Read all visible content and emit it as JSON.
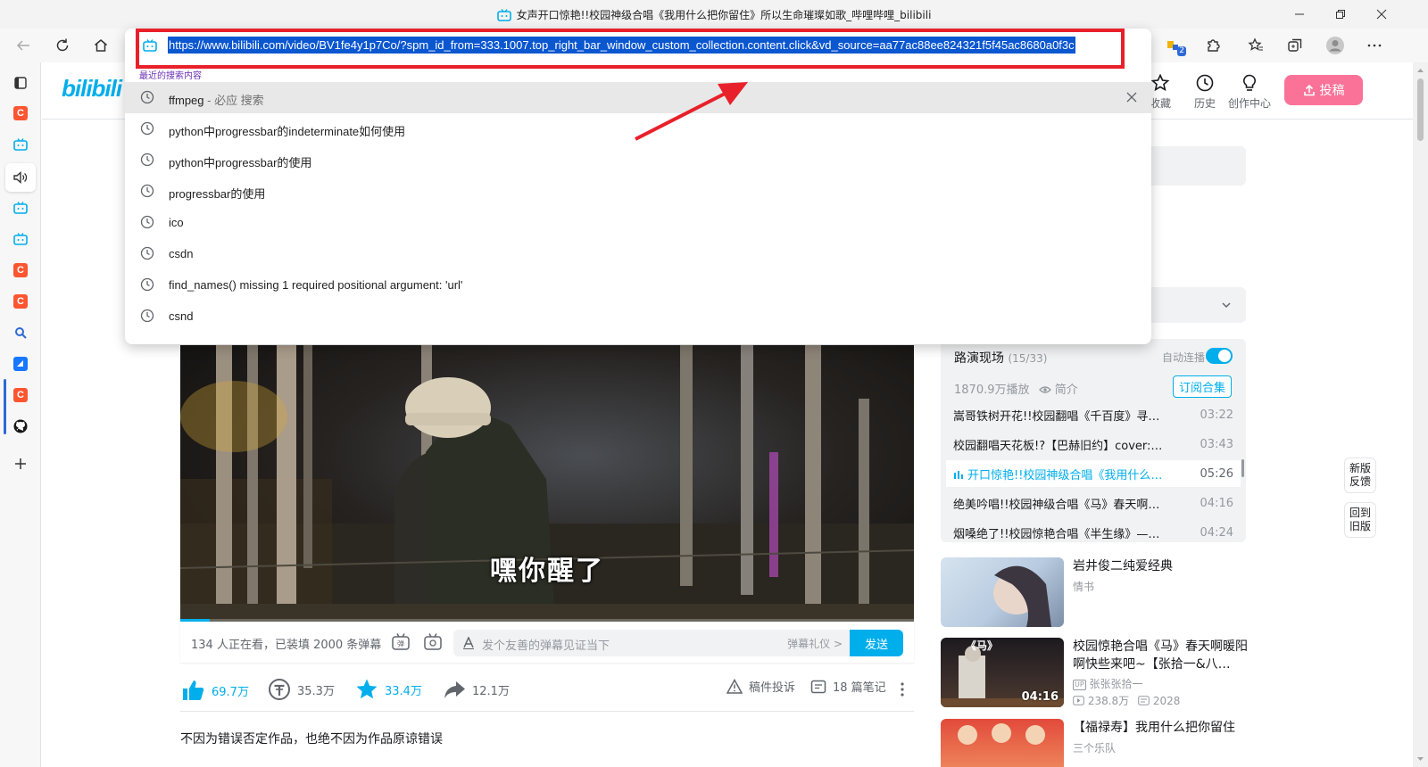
{
  "window": {
    "title": "女声开口惊艳!!校园神级合唱《我用什么把你留住》所以生命璀璨如歌_哔哩哔哩_bilibili"
  },
  "toolbar": {
    "extension_badge": "2"
  },
  "omnibox": {
    "url": "https://www.bilibili.com/video/BV1fe4y1p7Co/?spm_id_from=333.1007.top_right_bar_window_custom_collection.content.click&vd_source=aa77ac88ee824321f5f45ac8680a0f3c",
    "recent_label": "最近的搜索内容",
    "suggestions": [
      {
        "text": "ffmpeg",
        "hint": " - 必应 搜索"
      },
      {
        "text": "python中progressbar的indeterminate如何使用",
        "hint": ""
      },
      {
        "text": "python中progressbar的使用",
        "hint": ""
      },
      {
        "text": "progressbar的使用",
        "hint": ""
      },
      {
        "text": "ico",
        "hint": ""
      },
      {
        "text": "csdn",
        "hint": ""
      },
      {
        "text": "find_names() missing 1 required positional argument: 'url'",
        "hint": ""
      },
      {
        "text": "csnd",
        "hint": ""
      }
    ]
  },
  "site": {
    "logo": "bilibili",
    "nav": {
      "favorites": "收藏",
      "history": "历史",
      "creator": "创作中心"
    },
    "upload": "投稿"
  },
  "video": {
    "subtitle": "嘿你醒了",
    "progress": 0.04,
    "watching": "134 人正在看，已装填 2000 条弹幕",
    "danmaku_placeholder": "发个友善的弹幕见证当下",
    "danmaku_etiquette": "弹幕礼仪 >",
    "send": "发送"
  },
  "actions": {
    "like": "69.7万",
    "coin": "35.3万",
    "favorite": "33.4万",
    "share": "12.1万",
    "report": "稿件投诉",
    "notes": "18 篇笔记"
  },
  "description": "不因为错误否定作品，也绝不因为作品原谅错误",
  "playlist": {
    "title": "路演现场",
    "count": "(15/33)",
    "autoplay": "自动连播",
    "autoplay_on": true,
    "plays": "1870.9万播放",
    "intro": "简介",
    "subscribe": "订阅合集",
    "items": [
      {
        "title": "嵩哥铁树开花!!校园翻唱《千百度》寻…",
        "duration": "03:22"
      },
      {
        "title": "校园翻唱天花板!?【巴赫旧约】cover:…",
        "duration": "03:43"
      },
      {
        "title": "开口惊艳!!校园神级合唱《我用什么…",
        "duration": "05:26",
        "active": true
      },
      {
        "title": "绝美吟唱!!校园神级合唱《马》春天啊…",
        "duration": "04:16"
      },
      {
        "title": "烟嗓绝了!!校园惊艳合唱《半生缘》—…",
        "duration": "04:24"
      }
    ]
  },
  "recommendations": [
    {
      "title": "岩井俊二纯爱经典",
      "author": "情书"
    },
    {
      "title": "校园惊艳合唱《马》春天啊暖阳啊快些来吧~【张拾一&八…",
      "author": "张张张拾一",
      "views": "238.8万",
      "danmaku": "2028",
      "duration": "04:16",
      "thumb_text": "《马》"
    },
    {
      "title": "【福禄寿】我用什么把你留住",
      "author": "三个乐队"
    }
  ],
  "floating": {
    "feedback": "新版\n反馈",
    "old": "回到\n旧版"
  },
  "colors": {
    "bilibili_blue": "#00aeec",
    "upload_pink": "#fb7299",
    "highlight_box": "#e8202a",
    "url_selection": "#0b57d0"
  }
}
